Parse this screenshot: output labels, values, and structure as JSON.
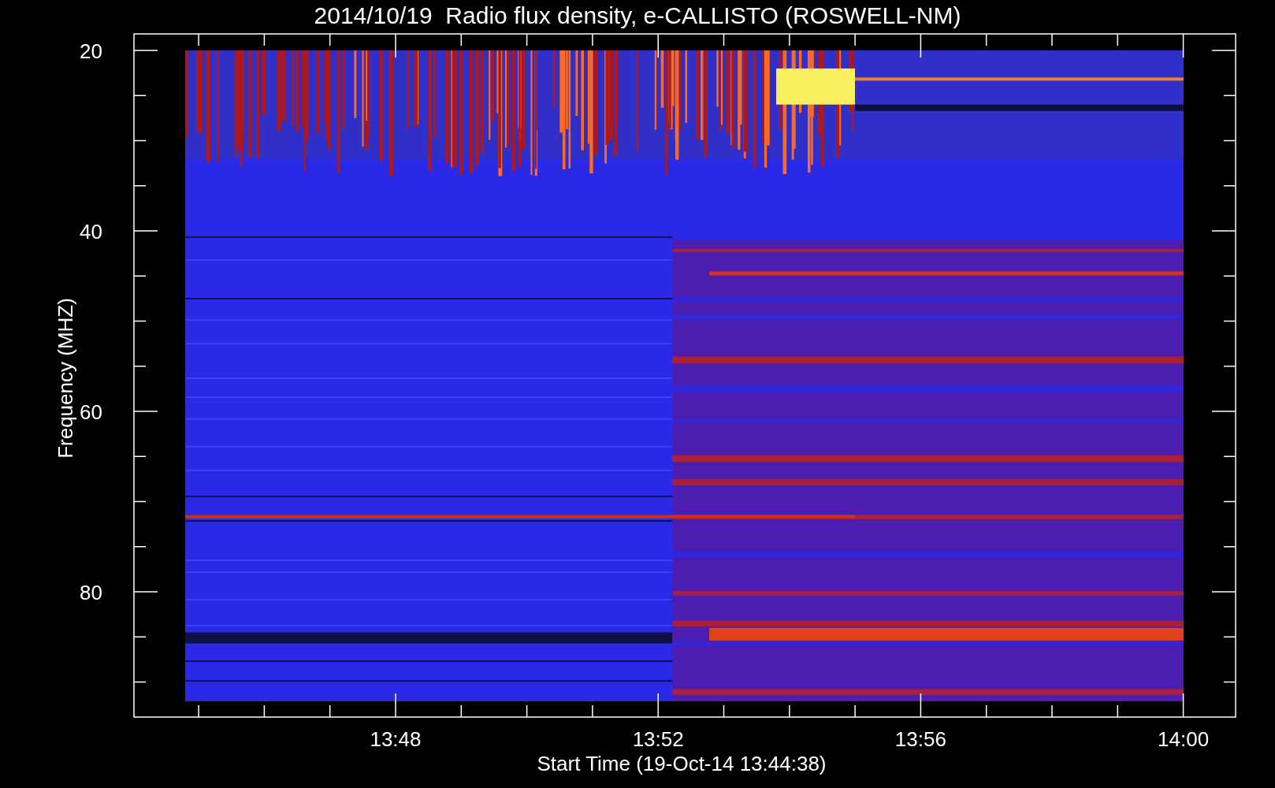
{
  "title": "2014/10/19  Radio flux density, e-CALLISTO (ROSWELL-NM)",
  "y_axis": {
    "label": "Frequency (MHZ)",
    "ticks": [
      "20",
      "40",
      "60",
      "80"
    ]
  },
  "x_axis": {
    "label": "Start Time (19-Oct-14 13:44:38)",
    "ticks": [
      "13:48",
      "13:52",
      "13:56",
      "14:00"
    ]
  }
}
